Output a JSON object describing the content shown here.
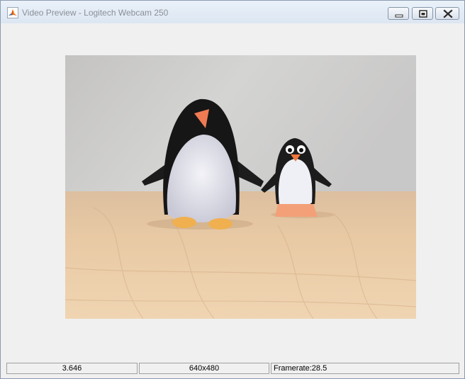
{
  "window": {
    "title": "Video Preview - Logitech Webcam 250"
  },
  "icons": {
    "app": "matlab-logo-icon",
    "minimize": "minimize-icon",
    "maximize": "restore-icon",
    "close": "close-icon"
  },
  "colors": {
    "window_background": "#f0f0f0",
    "titlebar": "#dce6f2",
    "title_text": "#8b8f95",
    "wall": "#cfcfcf",
    "table": "#e8c9a2"
  },
  "statusbar": {
    "timestamp": "3.646",
    "resolution": "640x480",
    "framerate": "Framerate:28.5"
  }
}
